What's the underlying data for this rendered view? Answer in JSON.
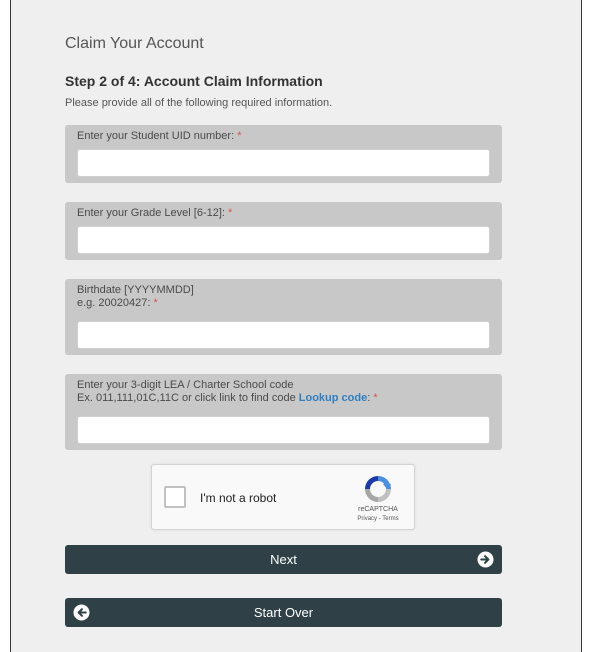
{
  "page_title": "Claim Your Account",
  "step": {
    "title": "Step 2 of 4: Account Claim Information",
    "description": "Please provide all of the following required information."
  },
  "fields": [
    {
      "label_line1": "Enter your Student UID number:",
      "required_mark": "*",
      "value": "",
      "placeholder": ""
    },
    {
      "label_line1": "Enter your Grade Level [6-12]:",
      "required_mark": "*",
      "value": "",
      "placeholder": ""
    },
    {
      "label_line1": "Birthdate [YYYYMMDD]",
      "label_line2": "e.g. 20020427:",
      "required_mark": "*",
      "value": "",
      "placeholder": ""
    },
    {
      "label_line1": "Enter your 3-digit LEA / Charter School code",
      "label_line2": "Ex. 011,111,01C,11C or click link to find code",
      "link_text": "Lookup code",
      "link_suffix": ":",
      "required_mark": "*",
      "value": "",
      "placeholder": ""
    }
  ],
  "recaptcha": {
    "label": "I'm not a robot",
    "brand": "reCAPTCHA",
    "links": "Privacy - Terms",
    "icon": "recaptcha-logo-icon"
  },
  "buttons": {
    "next_label": "Next",
    "next_icon": "arrow-right-circle-icon",
    "start_over_label": "Start Over",
    "start_over_icon": "arrow-left-circle-icon"
  },
  "colors": {
    "button_bg": "#2f4146",
    "field_group_bg": "#c8c8c8",
    "required": "#d9534f",
    "link": "#2f7fc1",
    "page_bg": "#efefef"
  }
}
